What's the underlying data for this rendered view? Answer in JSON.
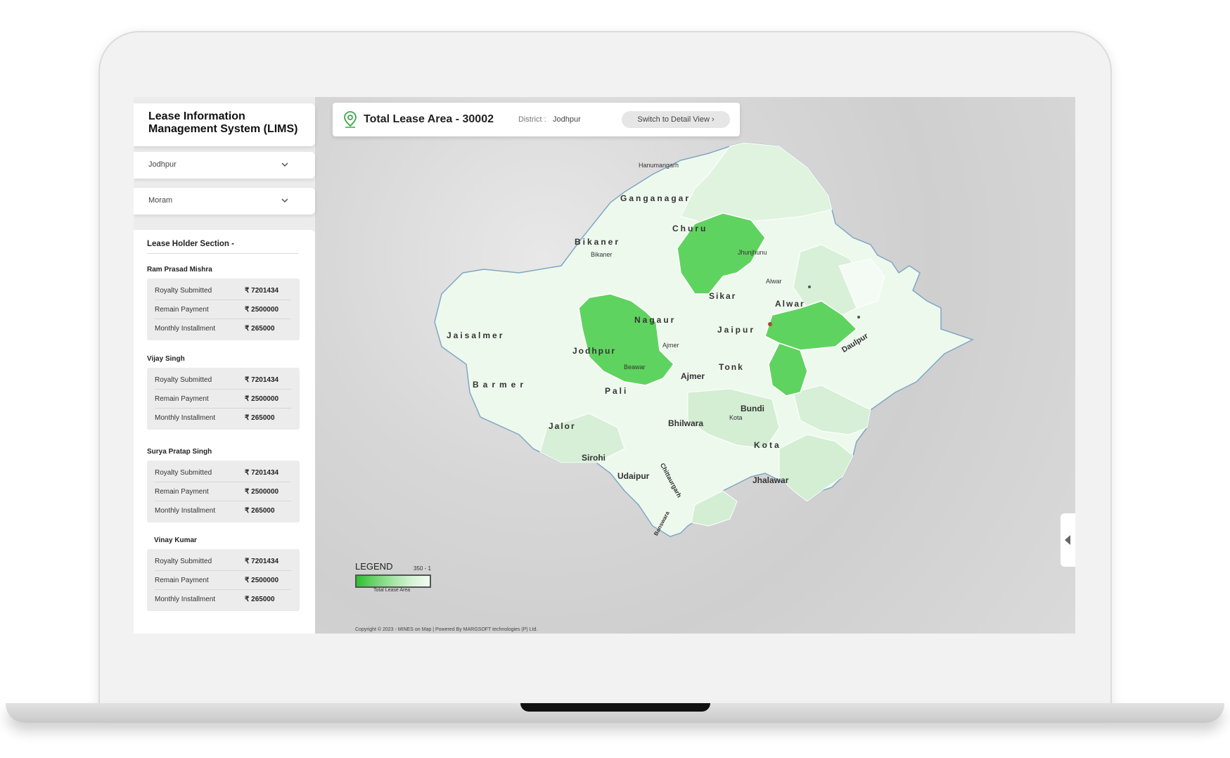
{
  "app": {
    "title": "Lease Information Management System (LIMS)"
  },
  "filters": {
    "district": "Jodhpur",
    "mineral": "Moram"
  },
  "info_bar": {
    "total_lease_area": "Total Lease Area - 30002",
    "district_label": "District :",
    "district_value": "Jodhpur",
    "switch_label": "Switch to Detail View ›"
  },
  "lease_section": {
    "title": "Lease Holder Section -",
    "holders": [
      {
        "name": "Ram Prasad Mishra",
        "rows": [
          {
            "label": "Royalty Submitted",
            "value": "₹ 7201434"
          },
          {
            "label": "Remain Payment",
            "value": "₹ 2500000"
          },
          {
            "label": "Monthly Installment",
            "value": "₹ 265000"
          }
        ]
      },
      {
        "name": "Vijay Singh",
        "rows": [
          {
            "label": "Royalty Submitted",
            "value": "₹ 7201434"
          },
          {
            "label": "Remain Payment",
            "value": "₹ 2500000"
          },
          {
            "label": "Monthly Installment",
            "value": "₹ 265000"
          }
        ]
      },
      {
        "name": "Surya Pratap Singh",
        "rows": [
          {
            "label": "Royalty Submitted",
            "value": "₹ 7201434"
          },
          {
            "label": "Remain Payment",
            "value": "₹ 2500000"
          },
          {
            "label": "Monthly Installment",
            "value": "₹ 265000"
          }
        ]
      },
      {
        "name": "Vinay Kumar",
        "rows": [
          {
            "label": "Royalty Submitted",
            "value": "₹ 7201434"
          },
          {
            "label": "Remain Payment",
            "value": "₹ 2500000"
          },
          {
            "label": "Monthly Installment",
            "value": "₹ 265000"
          }
        ]
      }
    ]
  },
  "legend": {
    "title": "LEGEND",
    "range": "350 - 1",
    "caption": "Total Lease Area"
  },
  "map": {
    "districts": [
      "Ganganagar",
      "Churu",
      "Bikaner",
      "Sikar",
      "Alwar",
      "Nagaur",
      "Jaipur",
      "Jaisalmer",
      "Jodhpur",
      "Tonk",
      "Ajmer",
      "Barmer",
      "Pali",
      "Bundi",
      "Bhilwara",
      "Jalor",
      "Kota",
      "Sirohi",
      "Udaipur",
      "Jhalawar",
      "Daulpur",
      "Chittaurgarh",
      "Banswara"
    ],
    "towns": [
      "Hanumangarh",
      "Bikaner",
      "Jhunjhunu",
      "Alwar",
      "Ajmer",
      "Beawar",
      "Kota"
    ],
    "highlight_color": "#5fd35f",
    "light_color": "#e3f5e3"
  },
  "footer": {
    "copyright": "Copyright © 2023 - MINES on Map  |  Powered By MARGSOFT technologies (P) Ltd."
  },
  "icons": {
    "location": "location-pin-icon",
    "dropdown": "chevron-down-icon",
    "collapse": "caret-left-icon"
  }
}
